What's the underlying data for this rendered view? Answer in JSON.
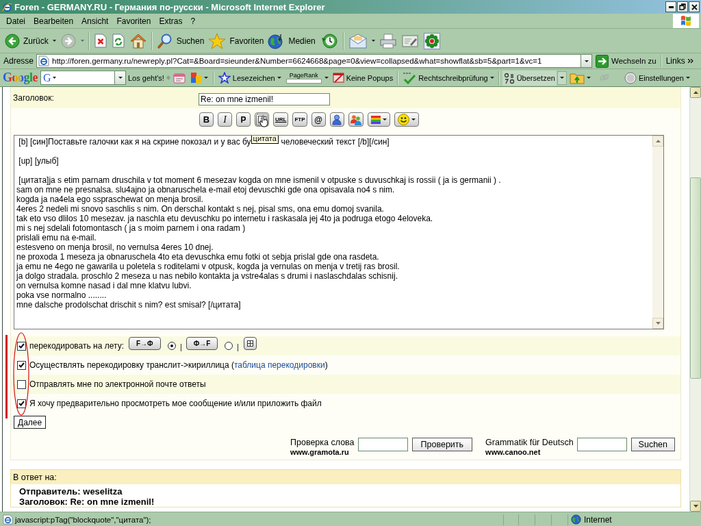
{
  "window": {
    "title": "Foren - GERMANY.RU - Германия по-русски - Microsoft Internet Explorer"
  },
  "menu": [
    {
      "label": "Datei"
    },
    {
      "label": "Bearbeiten"
    },
    {
      "label": "Ansicht"
    },
    {
      "label": "Favoriten"
    },
    {
      "label": "Extras"
    },
    {
      "label": "?"
    }
  ],
  "toolbar": {
    "back": "Zurück",
    "search": "Suchen",
    "favorites": "Favoriten",
    "media": "Medien"
  },
  "address_bar": {
    "label": "Adresse",
    "url": "http://foren.germany.ru/newreply.pl?Cat=&Board=sieunder&Number=6624668&page=0&view=collapsed&what=showflat&sb=5&part=1&vc=1",
    "go": "Wechseln zu",
    "links": "Links"
  },
  "google_bar": {
    "logo": "Google",
    "field_logo": "G",
    "search_button": "Los geht's!",
    "bookmarks": "Lesezeichen",
    "pagerank": "PageRank",
    "popups": "Keine Popups",
    "spellcheck": "Rechtschreibprüfung",
    "translate": "Übersetzen",
    "settings": "Einstellungen"
  },
  "form": {
    "subject_label": "Заголовок:",
    "subject_value": "Re: on mne izmenil!",
    "bold": "B",
    "italic": "I",
    "plain": "P",
    "quote": {
      "focused": true,
      "tooltip": "цитата"
    },
    "url": "URL",
    "ftp": "FTP",
    "email": "@",
    "message": {
      "first_line": {
        "before": " [b] [син]Поставьте галочки как я на скрине покозал и у вас бу",
        "after": "человеческий текст [/b][/син]"
      },
      "paragraphs": [
        [
          " [up] [улыб]"
        ],
        [
          " [цитата]ja s etim parnam druschila v tot moment 6 mesezav kogda on mne ismenil v otpuske s duvuschkaj is rossii ( ja is germanii ) .",
          "sam on mne ne presnalsa. slu4ajno ja obnaruschela e-mail etoj devuschki gde ona opisavala no4 s nim.",
          "kogda ja na4ela ego sspraschewat on menja brosil.",
          "4eres 2 nedeli mi snovo saschlis s nim. On derschal kontakt s nej, pisal sms, ona emu domoj svanila.",
          "tak eto vso dlilos 10 mesezav. ja naschla etu devuschku po internetu i raskasala jej 4to ja podruga etogo 4eloveka.",
          "mi s nej sdelali fotomontasch ( ja s moim parnem i ona radam )",
          "prislali emu na e-mail.",
          "estesveno on menja brosil, no vernulsa 4eres 10 dnej.",
          "ne proxoda 1 meseza ja obnaruschela 4to eta devuschka emu fotki ot sebja prislal gde ona rasdeta.",
          "ja emu ne 4ego ne gawarila u poletela s roditelami v otpusk, kogda ja vernulas on menja v tretij ras brosil.",
          "ja dolgo stradala. proschlo 2 meseza u nas nebilo kontakta ja vstre4alas s drumi i naslaschdalas schisnij.",
          "on vernulsa komne nasad i dal mne klatvu lubvi.",
          "poka vse normalno ........",
          "mne dalsche prodolschat drischit s nim? est smisal? [/цитата]"
        ]
      ]
    }
  },
  "options": [
    {
      "kind": "encoder",
      "label": "перекодировать на лету:",
      "checked": true,
      "buttons": [
        {
          "label": "F→Ф",
          "selected": true
        },
        {
          "label": "Ф→F",
          "selected": false
        }
      ]
    },
    {
      "kind": "link",
      "label": "Осуществлять перекодировку транслит->кириллица (",
      "link": "таблица перекодировки",
      "label_after": ")",
      "checked": true
    },
    {
      "kind": "plain",
      "label": "Отправлять мне по электронной почте ответы",
      "checked": false
    },
    {
      "kind": "plain",
      "label": "Я хочу предварительно просмотреть мое сообщение и/или приложить файл",
      "checked": true
    }
  ],
  "continue_button": "Далее",
  "spellcheck": [
    {
      "label": "Проверка слова",
      "site": "www.gramota.ru",
      "button": "Проверить"
    },
    {
      "label": "Grammatik für Deutsch",
      "site": "www.canoo.net",
      "button": "Suchen"
    }
  ],
  "reply_to": {
    "header": "В ответ на:",
    "sender": "Отправитель: weselitza",
    "subject": "Заголовок: Re: on mne izmenil!"
  },
  "status_bar": {
    "text": "javascript:pTag(\"blockquote\",\"цитата\");",
    "zone": "Internet"
  }
}
